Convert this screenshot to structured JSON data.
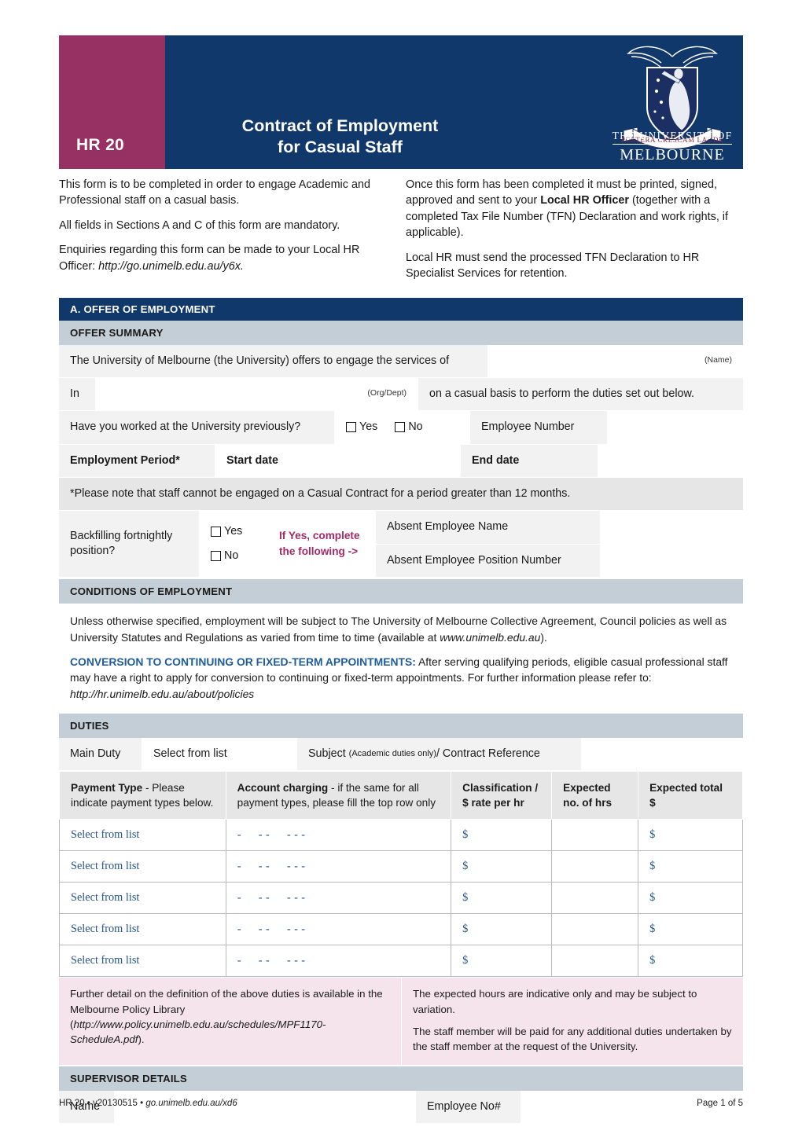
{
  "banner": {
    "code": "HR 20",
    "title_line1": "Contract of Employment",
    "title_line2": "for Casual Staff",
    "logo_line1": "THE UNIVERSITY OF",
    "logo_line2": "MELBOURNE",
    "logo_motto": "POSTERA CRESCAM LAUDE",
    "colors": {
      "magenta": "#983163",
      "navy": "#11386b"
    }
  },
  "intro": {
    "left": [
      "This form is to be completed in order to engage Academic and Professional staff on a casual basis.",
      "All fields in Sections A and C of this form are mandatory.",
      "Enquiries regarding this form can be made to your Local HR Officer: "
    ],
    "left_link": "http://go.unimelb.edu.au/y6x.",
    "right_p1_a": "Once this form has been completed it must be printed, signed, approved and sent to your ",
    "right_p1_bold": "Local HR Officer",
    "right_p1_b": " (together with a completed Tax File Number (TFN) Declaration and work rights, if applicable).",
    "right_p2": "Local HR must send the processed TFN Declaration to HR Specialist Services for retention."
  },
  "sections": {
    "offer_of_employment": "A. OFFER OF EMPLOYMENT",
    "offer_summary": "OFFER SUMMARY",
    "conditions_of_employment": "CONDITIONS OF EMPLOYMENT",
    "duties": "DUTIES",
    "supervisor_details": "SUPERVISOR DETAILS"
  },
  "offer_summary": {
    "engage_text": "The University of Melbourne (the University) offers to engage the services of",
    "name_hint": "(Name)",
    "in_label": "In",
    "orgdept_hint": "(Org/Dept)",
    "casual_basis_text": "on a casual basis to perform the duties set out below.",
    "worked_previously_label": "Have you worked at the University previously?",
    "yes_label": "Yes",
    "no_label": "No",
    "employee_number_label": "Employee Number",
    "employment_period_label": "Employment Period*",
    "start_date_label": "Start date",
    "end_date_label": "End date",
    "period_note": "*Please note that staff cannot be engaged on a Casual Contract for a period greater than 12 months.",
    "backfilling_label": "Backfilling fortnightly position?",
    "if_yes_line1": "If Yes, complete",
    "if_yes_line2": "the following ->",
    "absent_employee_name_label": "Absent Employee Name",
    "absent_employee_position_label": "Absent Employee Position Number"
  },
  "conditions": {
    "p1_a": "Unless otherwise specified, employment will be subject to The University of Melbourne Collective Agreement, Council policies as well as University Statutes and Regulations as varied from time to time (available at ",
    "p1_link": "www.unimelb.edu.au",
    "p1_b": ").",
    "p2_head": "CONVERSION TO CONTINUING OR FIXED-TERM APPOINTMENTS:",
    "p2_body": " After serving qualifying periods, eligible casual professional staff may have a right to apply for conversion to continuing or fixed-term appointments. For further information please refer to: ",
    "p2_link": "http://hr.unimelb.edu.au/about/policies"
  },
  "duties": {
    "main_duty_label": "Main Duty",
    "main_duty_value": "Select from list",
    "subject_label_a": "Subject",
    "subject_label_small": "(Academic duties only)",
    "subject_label_b": " / Contract Reference",
    "columns": [
      {
        "bold": "Payment Type",
        "rest": " - Please indicate payment types below."
      },
      {
        "bold": "Account charging",
        "rest": " - if the same for all payment types, please fill the top row only"
      },
      {
        "bold": "Classification / $ rate per hr",
        "rest": ""
      },
      {
        "bold": "Expected no. of hrs",
        "rest": ""
      },
      {
        "bold": "Expected total $",
        "rest": ""
      }
    ],
    "rows": [
      {
        "payment_type": "Select from list",
        "account": "-  - -   - - -",
        "rate": "$",
        "hrs": "",
        "total": "$"
      },
      {
        "payment_type": "Select from list",
        "account": "-  - -   - - -",
        "rate": "$",
        "hrs": "",
        "total": "$"
      },
      {
        "payment_type": "Select from list",
        "account": "-  - -   - - -",
        "rate": "$",
        "hrs": "",
        "total": "$"
      },
      {
        "payment_type": "Select from list",
        "account": "-  - -   - - -",
        "rate": "$",
        "hrs": "",
        "total": "$"
      },
      {
        "payment_type": "Select from list",
        "account": "-  - -   - - -",
        "rate": "$",
        "hrs": "",
        "total": "$"
      }
    ],
    "note_left_a": "Further detail on the definition of the above duties is available in the Melbourne Policy Library (",
    "note_left_link": "http://www.policy.unimelb.edu.au/schedules/MPF1170-ScheduleA.pdf",
    "note_left_b": ").",
    "note_right_1": "The expected hours are indicative only and may be subject to variation.",
    "note_right_2": "The staff member will be paid for any additional duties undertaken by the staff member at the request of the University."
  },
  "supervisor": {
    "name_label": "Name",
    "employee_no_label": "Employee No#"
  },
  "footer": {
    "left": "HR 20 • v20130515 • ",
    "left_link": "go.unimelb.edu.au/xd6",
    "right": "Page 1 of 5"
  }
}
